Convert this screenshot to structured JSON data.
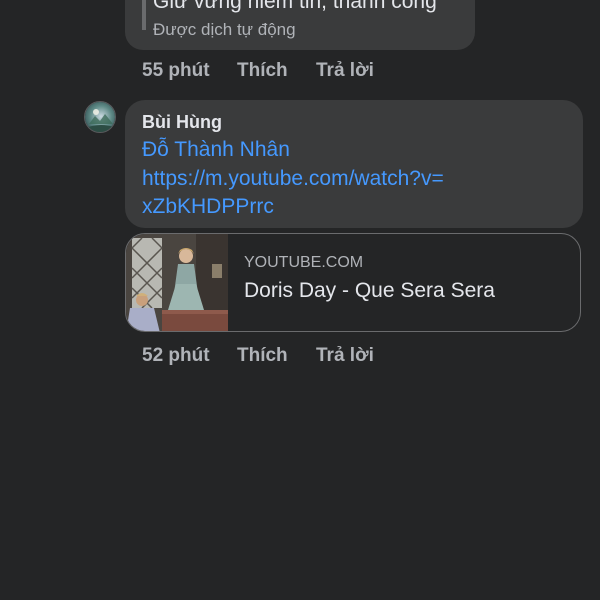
{
  "previous_comment": {
    "text": "Giữ vững niềm tin, thành công",
    "translation_note": "Được dịch tự động",
    "meta": {
      "time": "55 phút",
      "like": "Thích",
      "reply": "Trả lời"
    }
  },
  "comment": {
    "author": "Bùi Hùng",
    "mention": "Đỗ Thành Nhân",
    "link_line1": "https://m.youtube.com/watch?v=",
    "link_line2": "xZbKHDPPrrc",
    "preview": {
      "domain": "YOUTUBE.COM",
      "title": "Doris Day - Que Sera Sera"
    },
    "meta": {
      "time": "52 phút",
      "like": "Thích",
      "reply": "Trả lời"
    }
  },
  "colors": {
    "background": "#242526",
    "bubble": "#3a3b3c",
    "link": "#4599ff",
    "secondary_text": "#b0b3b8",
    "primary_text": "#e4e6eb"
  }
}
